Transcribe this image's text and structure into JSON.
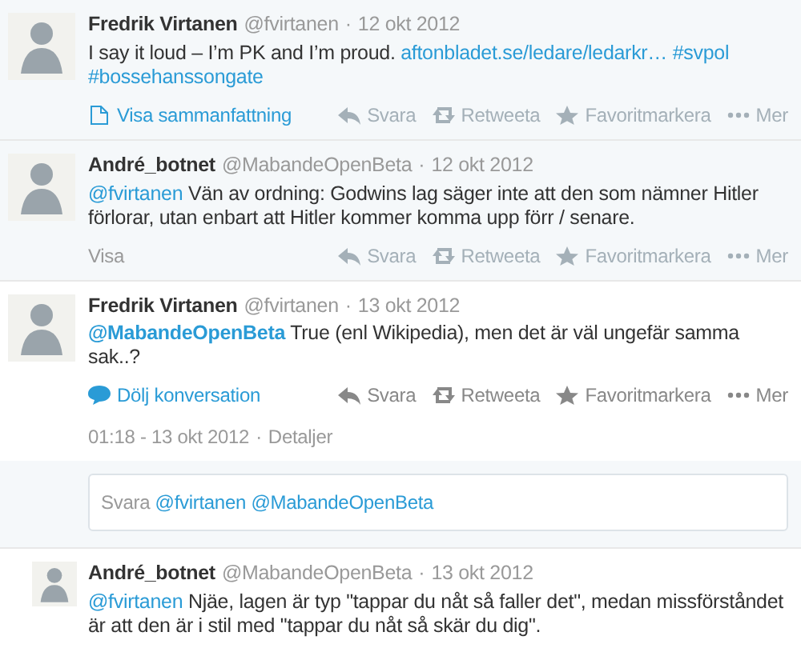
{
  "tweets": [
    {
      "name": "Fredrik Virtanen",
      "handle": "@fvirtanen",
      "separator": "·",
      "date": "12 okt 2012",
      "focused": false,
      "text": [
        {
          "kind": "text",
          "text": "I say it loud – I’m PK and I’m proud."
        },
        {
          "kind": "link",
          "text": "aftonbladet.se/ledare/ledarkr…"
        },
        {
          "kind": "link",
          "text": "#svpol"
        },
        {
          "kind": "link",
          "text": "#bossehanssongate"
        }
      ],
      "expand": {
        "kind": "summary",
        "label": "Visa sammanfattning"
      },
      "actions_dimmed": true,
      "actions": [
        {
          "kind": "reply",
          "label": "Svara"
        },
        {
          "kind": "retweet",
          "label": "Retweeta"
        },
        {
          "kind": "favorite",
          "label": "Favoritmarkera"
        },
        {
          "kind": "more",
          "label": "Mer"
        }
      ]
    },
    {
      "name": "André_botnet",
      "handle": "@MabandeOpenBeta",
      "separator": "·",
      "date": "12 okt 2012",
      "focused": false,
      "text": [
        {
          "kind": "link",
          "text": "@fvirtanen"
        },
        {
          "kind": "text",
          "text": "Vän av ordning: Godwins lag säger inte att den som nämner Hitler förlorar, utan enbart att Hitler kommer komma upp förr / senare."
        }
      ],
      "expand": {
        "kind": "plain",
        "label": "Visa"
      },
      "actions_dimmed": true,
      "actions": [
        {
          "kind": "reply",
          "label": "Svara"
        },
        {
          "kind": "retweet",
          "label": "Retweeta"
        },
        {
          "kind": "favorite",
          "label": "Favoritmarkera"
        },
        {
          "kind": "more",
          "label": "Mer"
        }
      ]
    },
    {
      "name": "Fredrik Virtanen",
      "handle": "@fvirtanen",
      "separator": "·",
      "date": "13 okt 2012",
      "focused": true,
      "text": [
        {
          "kind": "strong-link",
          "text": "@MabandeOpenBeta"
        },
        {
          "kind": "text",
          "text": "True (enl Wikipedia), men det är väl ungefär samma sak..?"
        }
      ],
      "expand": {
        "kind": "conversation",
        "label": "Dölj konversation"
      },
      "actions_dimmed": false,
      "actions": [
        {
          "kind": "reply",
          "label": "Svara"
        },
        {
          "kind": "retweet",
          "label": "Retweeta"
        },
        {
          "kind": "favorite",
          "label": "Favoritmarkera"
        },
        {
          "kind": "more",
          "label": "Mer"
        }
      ],
      "timestamp": "01:18 - 13 okt 2012",
      "timestamp_separator": "·",
      "details": "Detaljer",
      "reply_box": {
        "label": "Svara",
        "mentions": "@fvirtanen @MabandeOpenBeta"
      }
    },
    {
      "name": "André_botnet",
      "handle": "@MabandeOpenBeta",
      "separator": "·",
      "date": "13 okt 2012",
      "focused": false,
      "small": true,
      "text": [
        {
          "kind": "link",
          "text": "@fvirtanen"
        },
        {
          "kind": "text",
          "text": "Njäe, lagen är typ \"tappar du nåt så faller det\", medan missförståndet är att den är i stil med \"tappar du nåt så skär du dig\"."
        }
      ]
    }
  ]
}
